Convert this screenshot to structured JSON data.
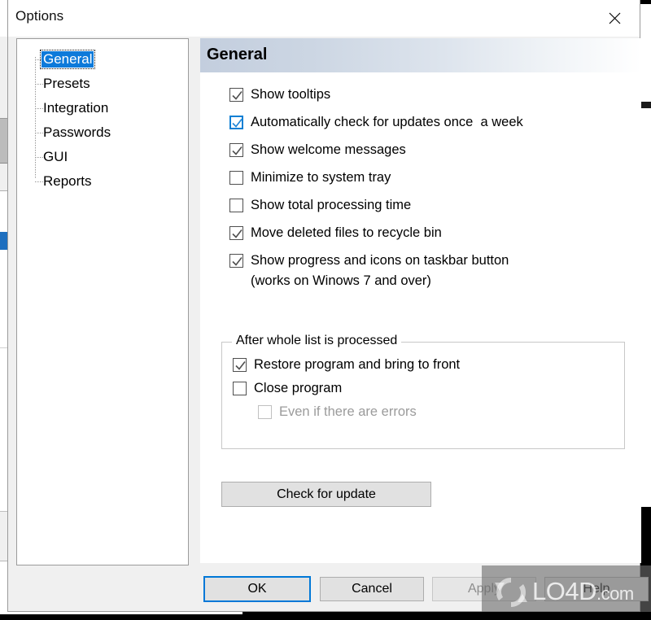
{
  "window": {
    "title": "Options",
    "close_icon": "close-icon"
  },
  "sidebar": {
    "items": [
      {
        "label": "General",
        "selected": true
      },
      {
        "label": "Presets",
        "selected": false
      },
      {
        "label": "Integration",
        "selected": false
      },
      {
        "label": "Passwords",
        "selected": false
      },
      {
        "label": "GUI",
        "selected": false
      },
      {
        "label": "Reports",
        "selected": false
      }
    ]
  },
  "content": {
    "header": "General",
    "checkboxes": [
      {
        "label": "Show tooltips",
        "checked": true,
        "focused": false,
        "disabled": false
      },
      {
        "label": "Automatically check for updates once  a week",
        "checked": true,
        "focused": true,
        "disabled": false
      },
      {
        "label": "Show welcome messages",
        "checked": true,
        "focused": false,
        "disabled": false
      },
      {
        "label": "Minimize to system tray",
        "checked": false,
        "focused": false,
        "disabled": false
      },
      {
        "label": "Show total processing time",
        "checked": false,
        "focused": false,
        "disabled": false
      },
      {
        "label": "Move deleted files to recycle bin",
        "checked": true,
        "focused": false,
        "disabled": false
      },
      {
        "label": "Show progress and icons on taskbar button",
        "checked": true,
        "focused": false,
        "disabled": false
      }
    ],
    "taskbar_note": "(works on Winows 7 and over)",
    "group": {
      "title": "After whole list is processed",
      "checkboxes": [
        {
          "label": "Restore program and bring to front",
          "checked": true,
          "disabled": false,
          "indent": false
        },
        {
          "label": "Close program",
          "checked": false,
          "disabled": false,
          "indent": false
        },
        {
          "label": "Even if there are errors",
          "checked": false,
          "disabled": true,
          "indent": true
        }
      ]
    },
    "check_update_button": "Check for update"
  },
  "buttons": {
    "ok": "OK",
    "cancel": "Cancel",
    "apply": "Apply",
    "help": "Help"
  },
  "watermark": {
    "name": "LO4D",
    "suffix": ".com"
  },
  "colors": {
    "selection_blue": "#0d7ada",
    "focus_blue": "#0078d7",
    "header_gradient_start": "#c3cede",
    "dialog_face": "#f0f0f0",
    "disabled_text": "#9b9b9b"
  }
}
